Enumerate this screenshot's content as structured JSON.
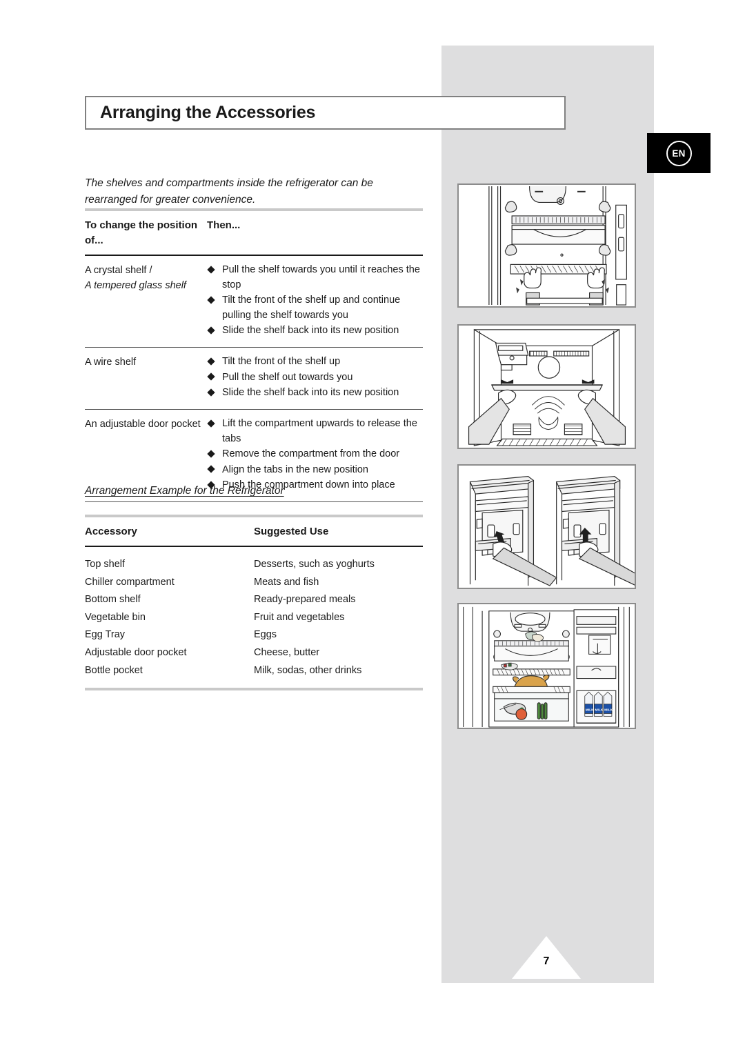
{
  "page": {
    "language_badge": "EN",
    "page_number": "7",
    "accent_grey": "#dededf",
    "rule_grey": "#c9c9c9",
    "rule_dark": "#1a1a1a",
    "badge_background": "#000000"
  },
  "heading": {
    "title": "Arranging the Accessories"
  },
  "intro": {
    "text": "The shelves and compartments inside the refrigerator can be rearranged for greater convenience."
  },
  "position_table": {
    "headers": {
      "col_a": "To change the position of...",
      "col_b": "Then..."
    },
    "rows": [
      {
        "accessory_line1": "A crystal shelf /",
        "accessory_line2": "A tempered glass shelf",
        "steps": [
          "Pull the shelf towards you until it reaches the stop",
          "Tilt the front of the shelf up and continue pulling the shelf towards you",
          "Slide the shelf back into its new position"
        ]
      },
      {
        "accessory_line1": "A wire shelf",
        "accessory_line2": "",
        "steps": [
          "Tilt the front of the shelf up",
          "Pull the shelf out towards you",
          "Slide the shelf back into its new position"
        ]
      },
      {
        "accessory_line1": "An adjustable door pocket",
        "accessory_line2": "",
        "steps": [
          "Lift the compartment upwards to release the tabs",
          "Remove the compartment from the door",
          "Align the tabs in the new position",
          "Push the compartment down into place"
        ]
      }
    ]
  },
  "subheading": {
    "text": "Arrangement Example for the Refrigerator"
  },
  "accessory_table": {
    "headers": {
      "col_a": "Accessory",
      "col_b": "Suggested Use"
    },
    "rows": [
      {
        "accessory": "Top shelf",
        "use": "Desserts, such as yoghurts"
      },
      {
        "accessory": "Chiller compartment",
        "use": "Meats and fish"
      },
      {
        "accessory": "Bottom shelf",
        "use": "Ready-prepared meals"
      },
      {
        "accessory": "Vegetable bin",
        "use": "Fruit and vegetables"
      },
      {
        "accessory": "Egg Tray",
        "use": "Eggs"
      },
      {
        "accessory": "Adjustable door pocket",
        "use": "Cheese, butter"
      },
      {
        "accessory": "Bottle pocket",
        "use": "Milk, sodas, other drinks"
      }
    ]
  },
  "illustrations": [
    {
      "name": "crystal-shelf-removal",
      "caption": ""
    },
    {
      "name": "wire-shelf-removal",
      "caption": ""
    },
    {
      "name": "door-pocket-removal",
      "caption": ""
    },
    {
      "name": "stocked-refrigerator-example",
      "caption": ""
    }
  ]
}
